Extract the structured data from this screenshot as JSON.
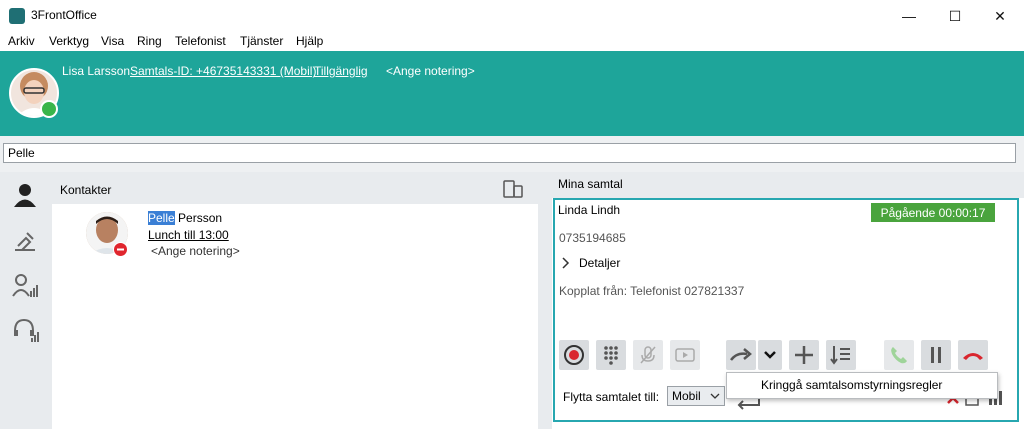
{
  "window": {
    "title": "3FrontOffice"
  },
  "menu": [
    "Arkiv",
    "Verktyg",
    "Visa",
    "Ring",
    "Telefonist",
    "Tjänster",
    "Hjälp"
  ],
  "header": {
    "user_name": "Lisa Larsson",
    "call_id": "Samtals-ID: +46735143331 (Mobil)",
    "availability": "Tillgänglig",
    "note_placeholder": "<Ange notering>",
    "presence_color": "#39b54a",
    "bar_color": "#1ea59a"
  },
  "search": {
    "value": "Pelle"
  },
  "contacts": {
    "title": "Kontakter",
    "items": [
      {
        "first_name_match": "Pelle",
        "last_name": " Persson",
        "status": "Lunch till 13:00",
        "note": "<Ange notering>",
        "presence_color": "#e0262e"
      }
    ]
  },
  "calls": {
    "title": "Mina samtal",
    "current": {
      "name": "Linda Lindh",
      "number": "0735194685",
      "status": "Pågående 00:00:17",
      "details_label": "Detaljer",
      "transferred_from": "Kopplat från: Telefonist 027821337",
      "status_color": "#4aa43d"
    },
    "move_label": "Flytta samtalet till:",
    "move_value": "Mobil",
    "popup_item": "Kringgå samtalsomstyrningsregler"
  },
  "icons": {
    "sidebar": [
      "contact-icon",
      "hand-pen-icon",
      "group-icon",
      "headset-icon"
    ],
    "controls": [
      "record-icon",
      "dialpad-icon",
      "mute-icon",
      "video-icon",
      "forward-icon",
      "dropdown-icon",
      "add-icon",
      "queue-icon",
      "answer-icon",
      "pause-icon",
      "hangup-icon"
    ]
  }
}
